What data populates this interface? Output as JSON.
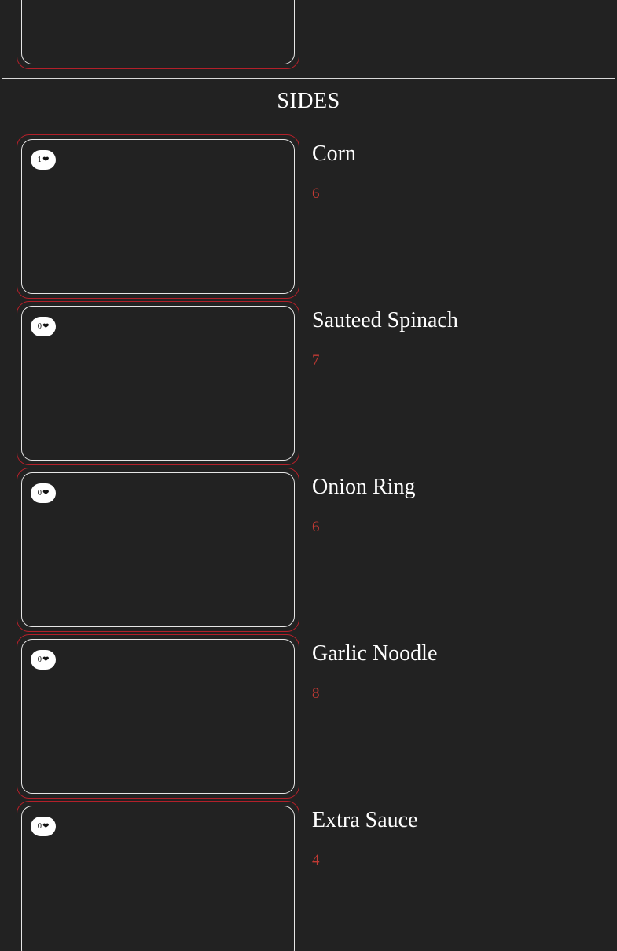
{
  "section": {
    "title": "SIDES"
  },
  "colors": {
    "background": "#222222",
    "accent_red": "#b3202a",
    "price_red": "#c23a34",
    "text": "#ffffff"
  },
  "items": [
    {
      "name": "Corn",
      "price": "6",
      "likes": "1",
      "like_icon": "heart-icon"
    },
    {
      "name": "Sauteed Spinach",
      "price": "7",
      "likes": "0",
      "like_icon": "heart-icon"
    },
    {
      "name": "Onion Ring",
      "price": "6",
      "likes": "0",
      "like_icon": "heart-icon"
    },
    {
      "name": "Garlic Noodle",
      "price": "8",
      "likes": "0",
      "like_icon": "heart-icon"
    },
    {
      "name": "Extra Sauce",
      "price": "4",
      "likes": "0",
      "like_icon": "heart-icon"
    }
  ]
}
